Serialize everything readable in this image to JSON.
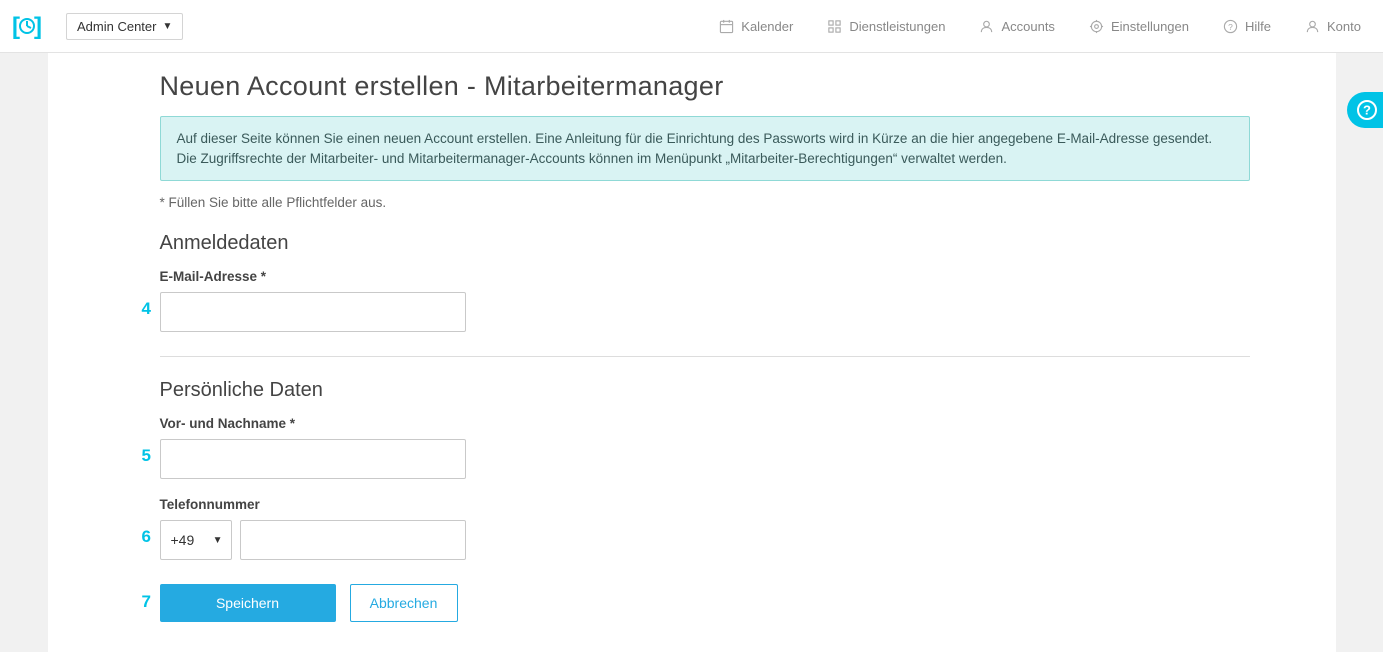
{
  "header": {
    "admin_select_label": "Admin Center",
    "nav": {
      "kalender": "Kalender",
      "dienst": "Dienstleistungen",
      "accounts": "Accounts",
      "einstellungen": "Einstellungen",
      "hilfe": "Hilfe",
      "konto": "Konto"
    }
  },
  "page": {
    "title": "Neuen Account erstellen - Mitarbeitermanager",
    "info_box": "Auf dieser Seite können Sie einen neuen Account erstellen. Eine Anleitung für die Einrichtung des Passworts wird in Kürze an die hier angegebene E-Mail-Adresse gesendet. Die Zugriffsrechte der Mitarbeiter- und Mitarbeitermanager-Accounts können im Menüpunkt „Mitarbeiter-Berechtigungen“ verwaltet werden.",
    "required_note": "* Füllen Sie bitte alle Pflichtfelder aus.",
    "section_login_heading": "Anmeldedaten",
    "email_label": "E-Mail-Adresse *",
    "section_personal_heading": "Persönliche Daten",
    "name_label": "Vor- und Nachname *",
    "phone_label": "Telefonnummer",
    "phone_prefix": "+49",
    "save_btn": "Speichern",
    "cancel_btn": "Abbrechen"
  },
  "markers": {
    "m4": "4",
    "m5": "5",
    "m6": "6",
    "m7": "7"
  }
}
